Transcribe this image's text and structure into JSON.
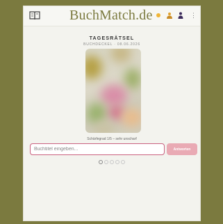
{
  "header": {
    "app_title": "BuchMatch.de",
    "icons": [
      "book-icon",
      "sun-icon",
      "stats-icon",
      "profile-icon",
      "menu-icon"
    ],
    "menu_glyph": "⋮"
  },
  "puzzle": {
    "title": "TAGESRÄTSEL",
    "subtitle": "BUCHDECKEL · 08.06.2026",
    "caption": "Schärfegrad 1/5 – sehr unscharf"
  },
  "guess": {
    "placeholder": "Buchtitel eingeben...",
    "value": "",
    "submit_label": "Antworten"
  },
  "attempts": {
    "total": 5,
    "current": 1
  },
  "colors": {
    "background": "#7b7a3f",
    "brand": "#7b7a3f",
    "accent": "#c9607e",
    "button": "#e9aab4"
  }
}
